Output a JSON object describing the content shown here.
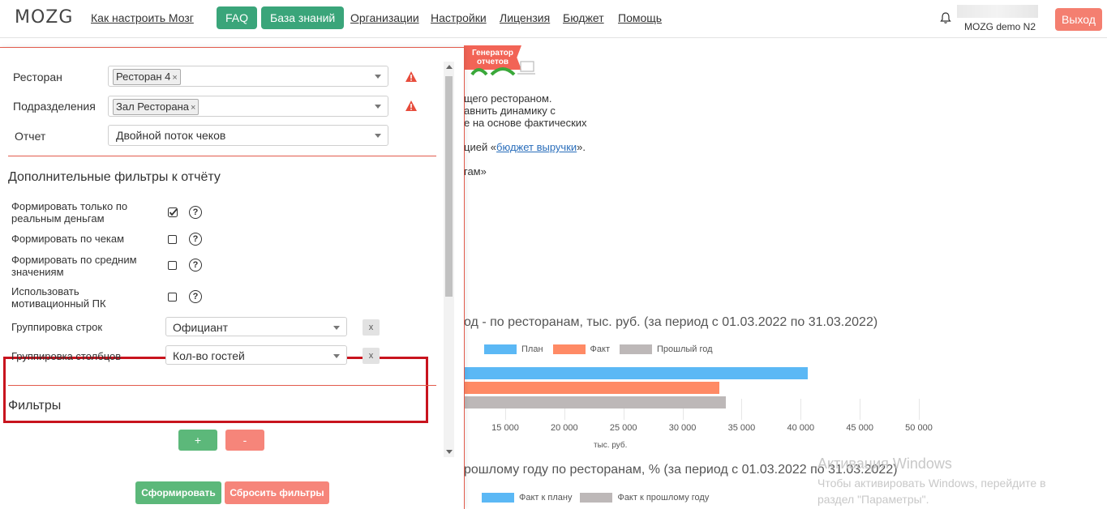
{
  "header": {
    "logo": "MOZG",
    "nav": [
      "Как настроить Мозг",
      "FAQ",
      "База знаний",
      "Организации",
      "Настройки",
      "Лицензия",
      "Бюджет",
      "Помощь"
    ],
    "user": "MOZG demo N2",
    "logout": "Выход"
  },
  "background": {
    "badge_line1": "Генератор",
    "badge_line2": "отчетов",
    "text1": "щего рестораном.",
    "text2": "авнить динамику с",
    "text3": "е на основе фактических",
    "text4_pre": "цией «",
    "text4_link": "бюджет выручки",
    "text4_post": "».",
    "text5": "гам»",
    "chart1_title": "од - по ресторанам, тыс. руб. (за период с 01.03.2022 по 31.03.2022)",
    "chart2_title": "рошлому году по ресторанам, % (за период с 01.03.2022 по 31.03.2022)",
    "legend2": [
      "Факт к плану",
      "Факт к прошлому году"
    ],
    "watermark_title": "Активация Windows",
    "watermark_line1": "Чтобы активировать Windows, перейдите в",
    "watermark_line2": "раздел \"Параметры\"."
  },
  "chart_data": {
    "type": "bar",
    "orientation": "horizontal",
    "title": "",
    "xlabel": "тыс. руб.",
    "xticks": [
      "15 000",
      "20 000",
      "25 000",
      "30 000",
      "35 000",
      "40 000",
      "45 000",
      "50 000"
    ],
    "xlim": [
      11500,
      50000
    ],
    "series": [
      {
        "name": "План",
        "color": "#5bb8f5",
        "values": [
          40600
        ]
      },
      {
        "name": "Факт",
        "color": "#ff8a65",
        "values": [
          33100
        ]
      },
      {
        "name": "Прошлый год",
        "color": "#bdb8b8",
        "values": [
          33700
        ]
      }
    ]
  },
  "panel": {
    "restaurant_label": "Ресторан",
    "restaurant_tag": "Ресторан 4",
    "division_label": "Подразделения",
    "division_tag": "Зал Ресторана",
    "report_label": "Отчет",
    "report_value": "Двойной поток чеков",
    "extra_title": "Дополнительные фильтры к отчёту",
    "options": [
      {
        "label": "Формировать только по реальным деньгам",
        "checked": true
      },
      {
        "label": "Формировать по чекам",
        "checked": false
      },
      {
        "label": "Формировать по средним значениям",
        "checked": false
      },
      {
        "label": "Использовать мотивационный ПК",
        "checked": false
      }
    ],
    "row_group_label": "Группировка строк",
    "row_group_value": "Официант",
    "col_group_label": "Группировка столбцов",
    "col_group_value": "Кол-во гостей",
    "clear": "x",
    "filters_title": "Фильтры",
    "plus": "+",
    "minus": "-",
    "submit": "Сформировать",
    "reset": "Сбросить фильтры",
    "help": "?",
    "tag_remove": "×"
  }
}
